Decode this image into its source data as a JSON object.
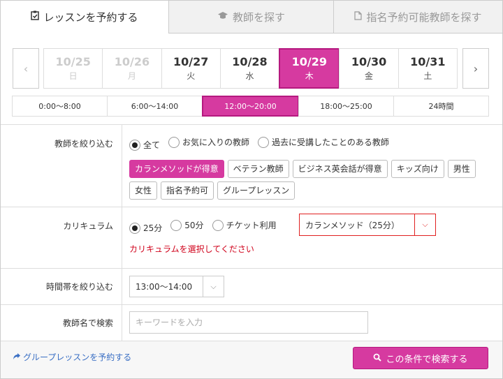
{
  "tabs": [
    {
      "label": "レッスンを予約する",
      "icon": "clipboard-check-icon",
      "glyph": "📋",
      "active": true
    },
    {
      "label": "教師を探す",
      "icon": "graduation-cap-icon",
      "glyph": "🎓",
      "active": false
    },
    {
      "label": "指名予約可能教師を探す",
      "icon": "document-icon",
      "glyph": "🗋",
      "active": false
    }
  ],
  "dates": [
    {
      "date": "10/25",
      "weekday": "日",
      "state": "past"
    },
    {
      "date": "10/26",
      "weekday": "月",
      "state": "past"
    },
    {
      "date": "10/27",
      "weekday": "火",
      "state": ""
    },
    {
      "date": "10/28",
      "weekday": "水",
      "state": ""
    },
    {
      "date": "10/29",
      "weekday": "木",
      "state": "sel"
    },
    {
      "date": "10/30",
      "weekday": "金",
      "state": ""
    },
    {
      "date": "10/31",
      "weekday": "土",
      "state": ""
    }
  ],
  "nav": {
    "prev_glyph": "‹",
    "next_glyph": "›"
  },
  "times": [
    {
      "label": "0:00〜8:00",
      "selected": false
    },
    {
      "label": "6:00〜14:00",
      "selected": false
    },
    {
      "label": "12:00〜20:00",
      "selected": true
    },
    {
      "label": "18:00〜25:00",
      "selected": false
    },
    {
      "label": "24時間",
      "selected": false
    }
  ],
  "teacher_filter": {
    "label": "教師を絞り込む",
    "radios": [
      {
        "label": "全て",
        "checked": true
      },
      {
        "label": "お気に入りの教師",
        "checked": false
      },
      {
        "label": "過去に受講したことのある教師",
        "checked": false
      }
    ],
    "chips": [
      {
        "label": "カランメソッドが得意",
        "on": true
      },
      {
        "label": "ベテラン教師",
        "on": false
      },
      {
        "label": "ビジネス英会話が得意",
        "on": false
      },
      {
        "label": "キッズ向け",
        "on": false
      },
      {
        "label": "男性",
        "on": false
      },
      {
        "label": "女性",
        "on": false
      },
      {
        "label": "指名予約可",
        "on": false
      },
      {
        "label": "グループレッスン",
        "on": false
      }
    ]
  },
  "curriculum": {
    "label": "カリキュラム",
    "radios": [
      {
        "label": "25分",
        "checked": true
      },
      {
        "label": "50分",
        "checked": false
      },
      {
        "label": "チケット利用",
        "checked": false
      }
    ],
    "select_value": "カランメソッド（25分）",
    "error": "カリキュラムを選択してください"
  },
  "time_filter": {
    "label": "時間帯を絞り込む",
    "select_value": "13:00〜14:00"
  },
  "name_search": {
    "label": "教師名で検索",
    "placeholder": "キーワードを入力"
  },
  "footer": {
    "group_link": "グループレッスンを予約する",
    "search_button": "この条件で検索する"
  },
  "colors": {
    "accent": "#d63aa0",
    "error": "#d0021b",
    "link": "#3a6fc4"
  }
}
